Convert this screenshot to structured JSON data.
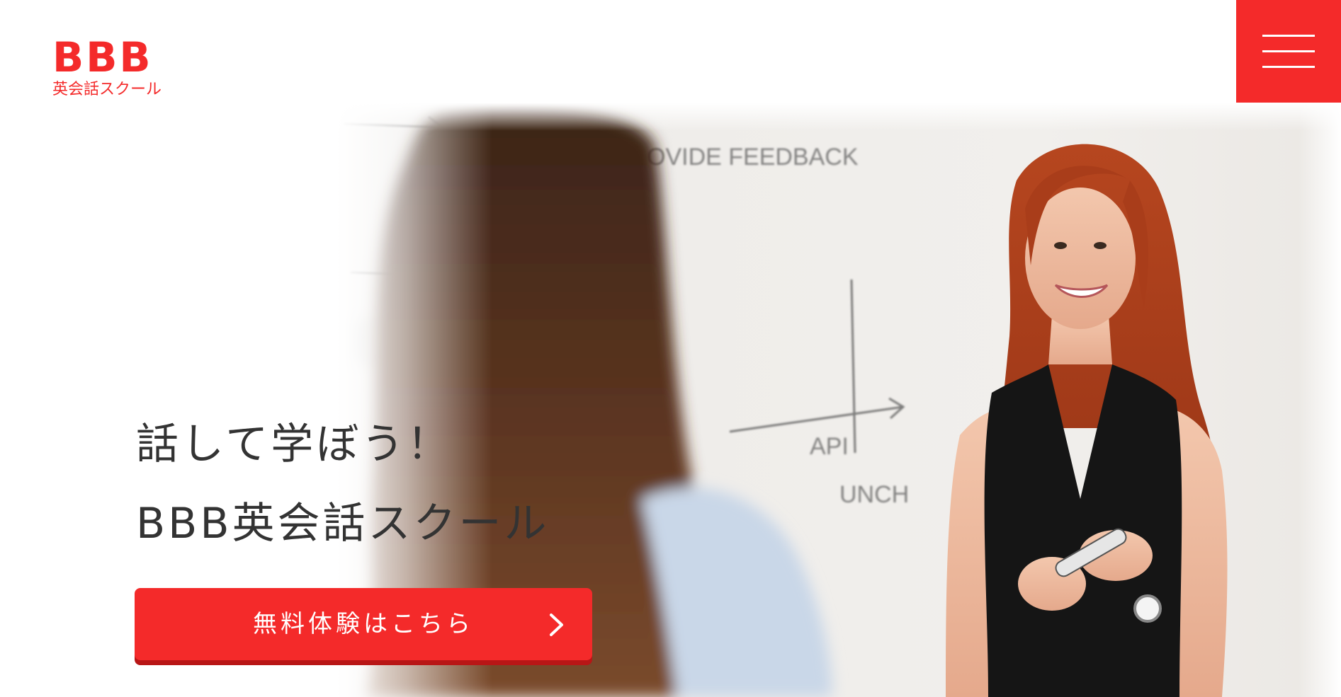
{
  "header": {
    "logo_mark": "BBB",
    "logo_sub": "英会話スクール",
    "menu_icon": "hamburger-menu-icon"
  },
  "hero": {
    "headline_line1": "話して学ぼう！",
    "headline_line2": "BBB英会話スクール",
    "photo_subject": "teacher at whiteboard photo",
    "whiteboard_text": {
      "feedback": "OVIDE FEEDBACK",
      "api": "API",
      "launch": "UNCH",
      "fragment": "EE"
    },
    "cta_label": "無料体験はこちら",
    "cta_icon": "chevron-right-icon"
  },
  "colors": {
    "accent": "#f42a2a",
    "accent_shadow": "#b81616",
    "text": "#333333",
    "background": "#ffffff"
  }
}
